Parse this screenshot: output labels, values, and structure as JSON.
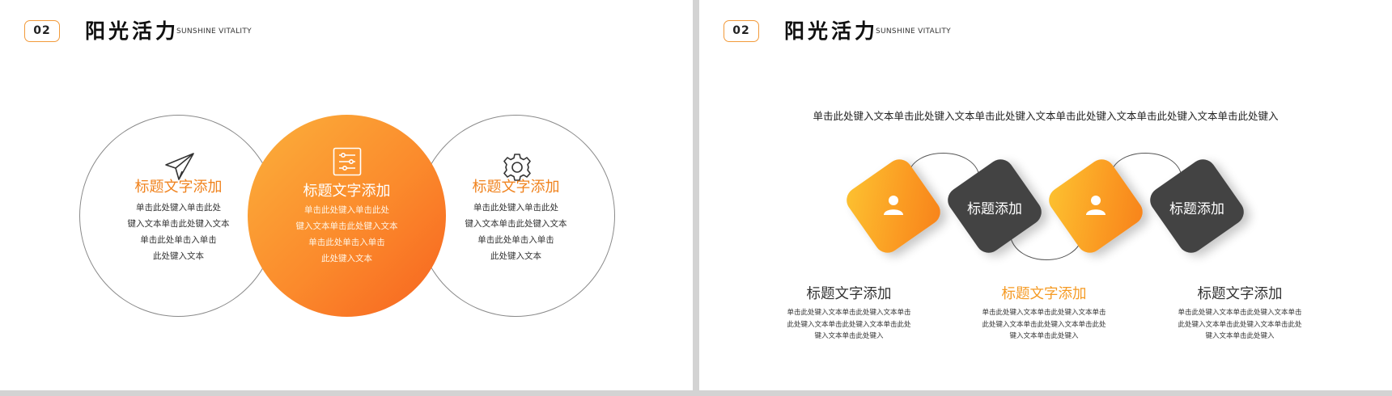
{
  "header": {
    "badge": "02",
    "title": "阳光活力",
    "subtitle": "SUNSHINE VITALITY"
  },
  "left_slide": {
    "circles": [
      {
        "icon": "paper-plane-icon",
        "title": "标题文字添加",
        "lines": [
          "单击此处键入单击此处",
          "键入文本单击此处键入文本",
          "单击此处单击入单击",
          "此处键入文本"
        ]
      },
      {
        "icon": "sliders-icon",
        "title": "标题文字添加",
        "lines": [
          "单击此处键入单击此处",
          "键入文本单击此处键入文本",
          "单击此处单击入单击",
          "此处键入文本"
        ]
      },
      {
        "icon": "gear-icon",
        "title": "标题文字添加",
        "lines": [
          "单击此处键入单击此处",
          "键入文本单击此处键入文本",
          "单击此处单击入单击",
          "此处键入文本"
        ]
      }
    ],
    "colors": {
      "accent": "#f0831e",
      "gradient_start": "#fbb03b",
      "gradient_end": "#f7631f",
      "outline": "#8a8a8a"
    }
  },
  "right_slide": {
    "lead_text": "单击此处键入文本单击此处键入文本单击此处键入文本单击此处键入文本单击此处键入文本单击此处键入",
    "tiles": [
      {
        "kind": "orange",
        "icon": "user-icon"
      },
      {
        "kind": "dark",
        "label": "标题添加"
      },
      {
        "kind": "orange",
        "icon": "user-icon"
      },
      {
        "kind": "dark",
        "label": "标题添加"
      }
    ],
    "columns": [
      {
        "title": "标题文字添加",
        "lines": [
          "单击此处键入文本单击此处键入文本单击",
          "此处键入文本单击此处键入文本单击此处",
          "键入文本单击此处键入"
        ]
      },
      {
        "title": "标题文字添加",
        "lines": [
          "单击此处键入文本单击此处键入文本单击",
          "此处键入文本单击此处键入文本单击此处",
          "键入文本单击此处键入"
        ]
      },
      {
        "title": "标题文字添加",
        "lines": [
          "单击此处键入文本单击此处键入文本单击",
          "此处键入文本单击此处键入文本单击此处",
          "键入文本单击此处键入"
        ]
      }
    ],
    "colors": {
      "orange": "#fb9a22",
      "dark": "#434343",
      "accent_title": "#f59a23"
    }
  }
}
